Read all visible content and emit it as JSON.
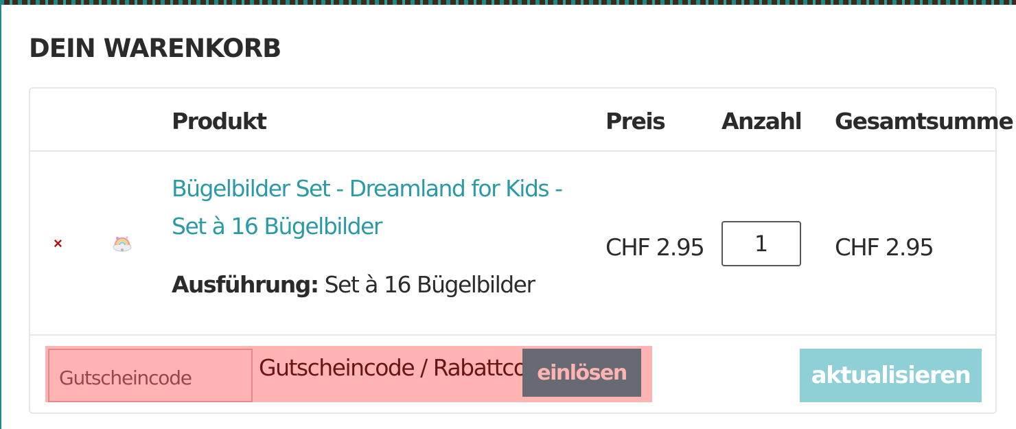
{
  "cart": {
    "title": "DEIN WARENKORB",
    "headers": {
      "product": "Produkt",
      "price": "Preis",
      "quantity": "Anzahl",
      "total": "Gesamtsumme"
    },
    "items": [
      {
        "remove_icon": "×",
        "thumbnail_icon": "dreamland-iron-on-thumbnail",
        "name": "Bügelbilder Set - Dreamland for Kids - Set à 16 Bügelbilder",
        "variant_label": "Ausführung:",
        "variant_value": "Set à 16 Bügelbilder",
        "price": "CHF 2.95",
        "quantity": "1",
        "subtotal": "CHF 2.95"
      }
    ],
    "coupon": {
      "placeholder": "Gutscheincode",
      "label": "Gutscheincode / Rabattcode:",
      "redeem_label": "einlösen"
    },
    "update_label": "aktualisieren"
  },
  "colors": {
    "link": "#2a9aa6",
    "remove": "#b30d0d",
    "coupon_highlight": "#ffb3b3",
    "redeem_button": "#676a72",
    "update_button": "#8fcfd6"
  }
}
